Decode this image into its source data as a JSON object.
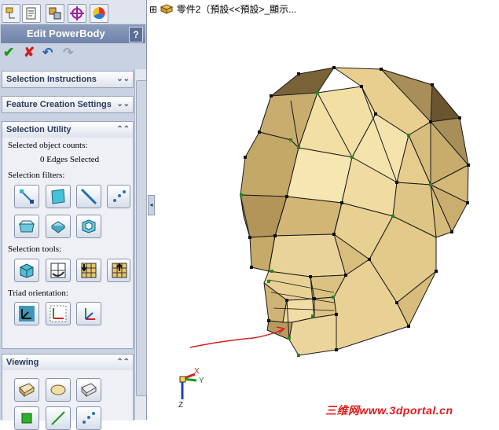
{
  "feature_tree": {
    "expander": "⊞",
    "root_label": "零件2（預設<<預設>_顯示..."
  },
  "property_manager": {
    "title": "Edit PowerBody",
    "help": "?",
    "ok_icon": "check-icon",
    "cancel_icon": "close-icon",
    "undo_icon": "undo-icon",
    "redo_icon": "redo-icon"
  },
  "groups": {
    "selection_instructions": "Selection Instructions",
    "feature_creation_settings": "Feature Creation Settings",
    "selection_utility": "Selection Utility",
    "viewing": "Viewing"
  },
  "selection_utility": {
    "counts_label": "Selected object counts:",
    "counts_value": "0 Edges Selected",
    "filters_label": "Selection filters:",
    "tools_label": "Selection tools:",
    "triad_label": "Triad orientation:"
  },
  "triad": {
    "x": "X",
    "y": "Y",
    "z": "Z"
  },
  "watermark": "三维网www.3dportal.cn",
  "colors": {
    "panel_bg": "#c9d2e3",
    "title_bar": "#7a8cb0",
    "face_light": "#f2dfa4",
    "face_shadow": "#a88f59",
    "face_dark": "#6b5430",
    "vertex_green": "#1f8a1f",
    "arrow_red": "#d42020"
  }
}
